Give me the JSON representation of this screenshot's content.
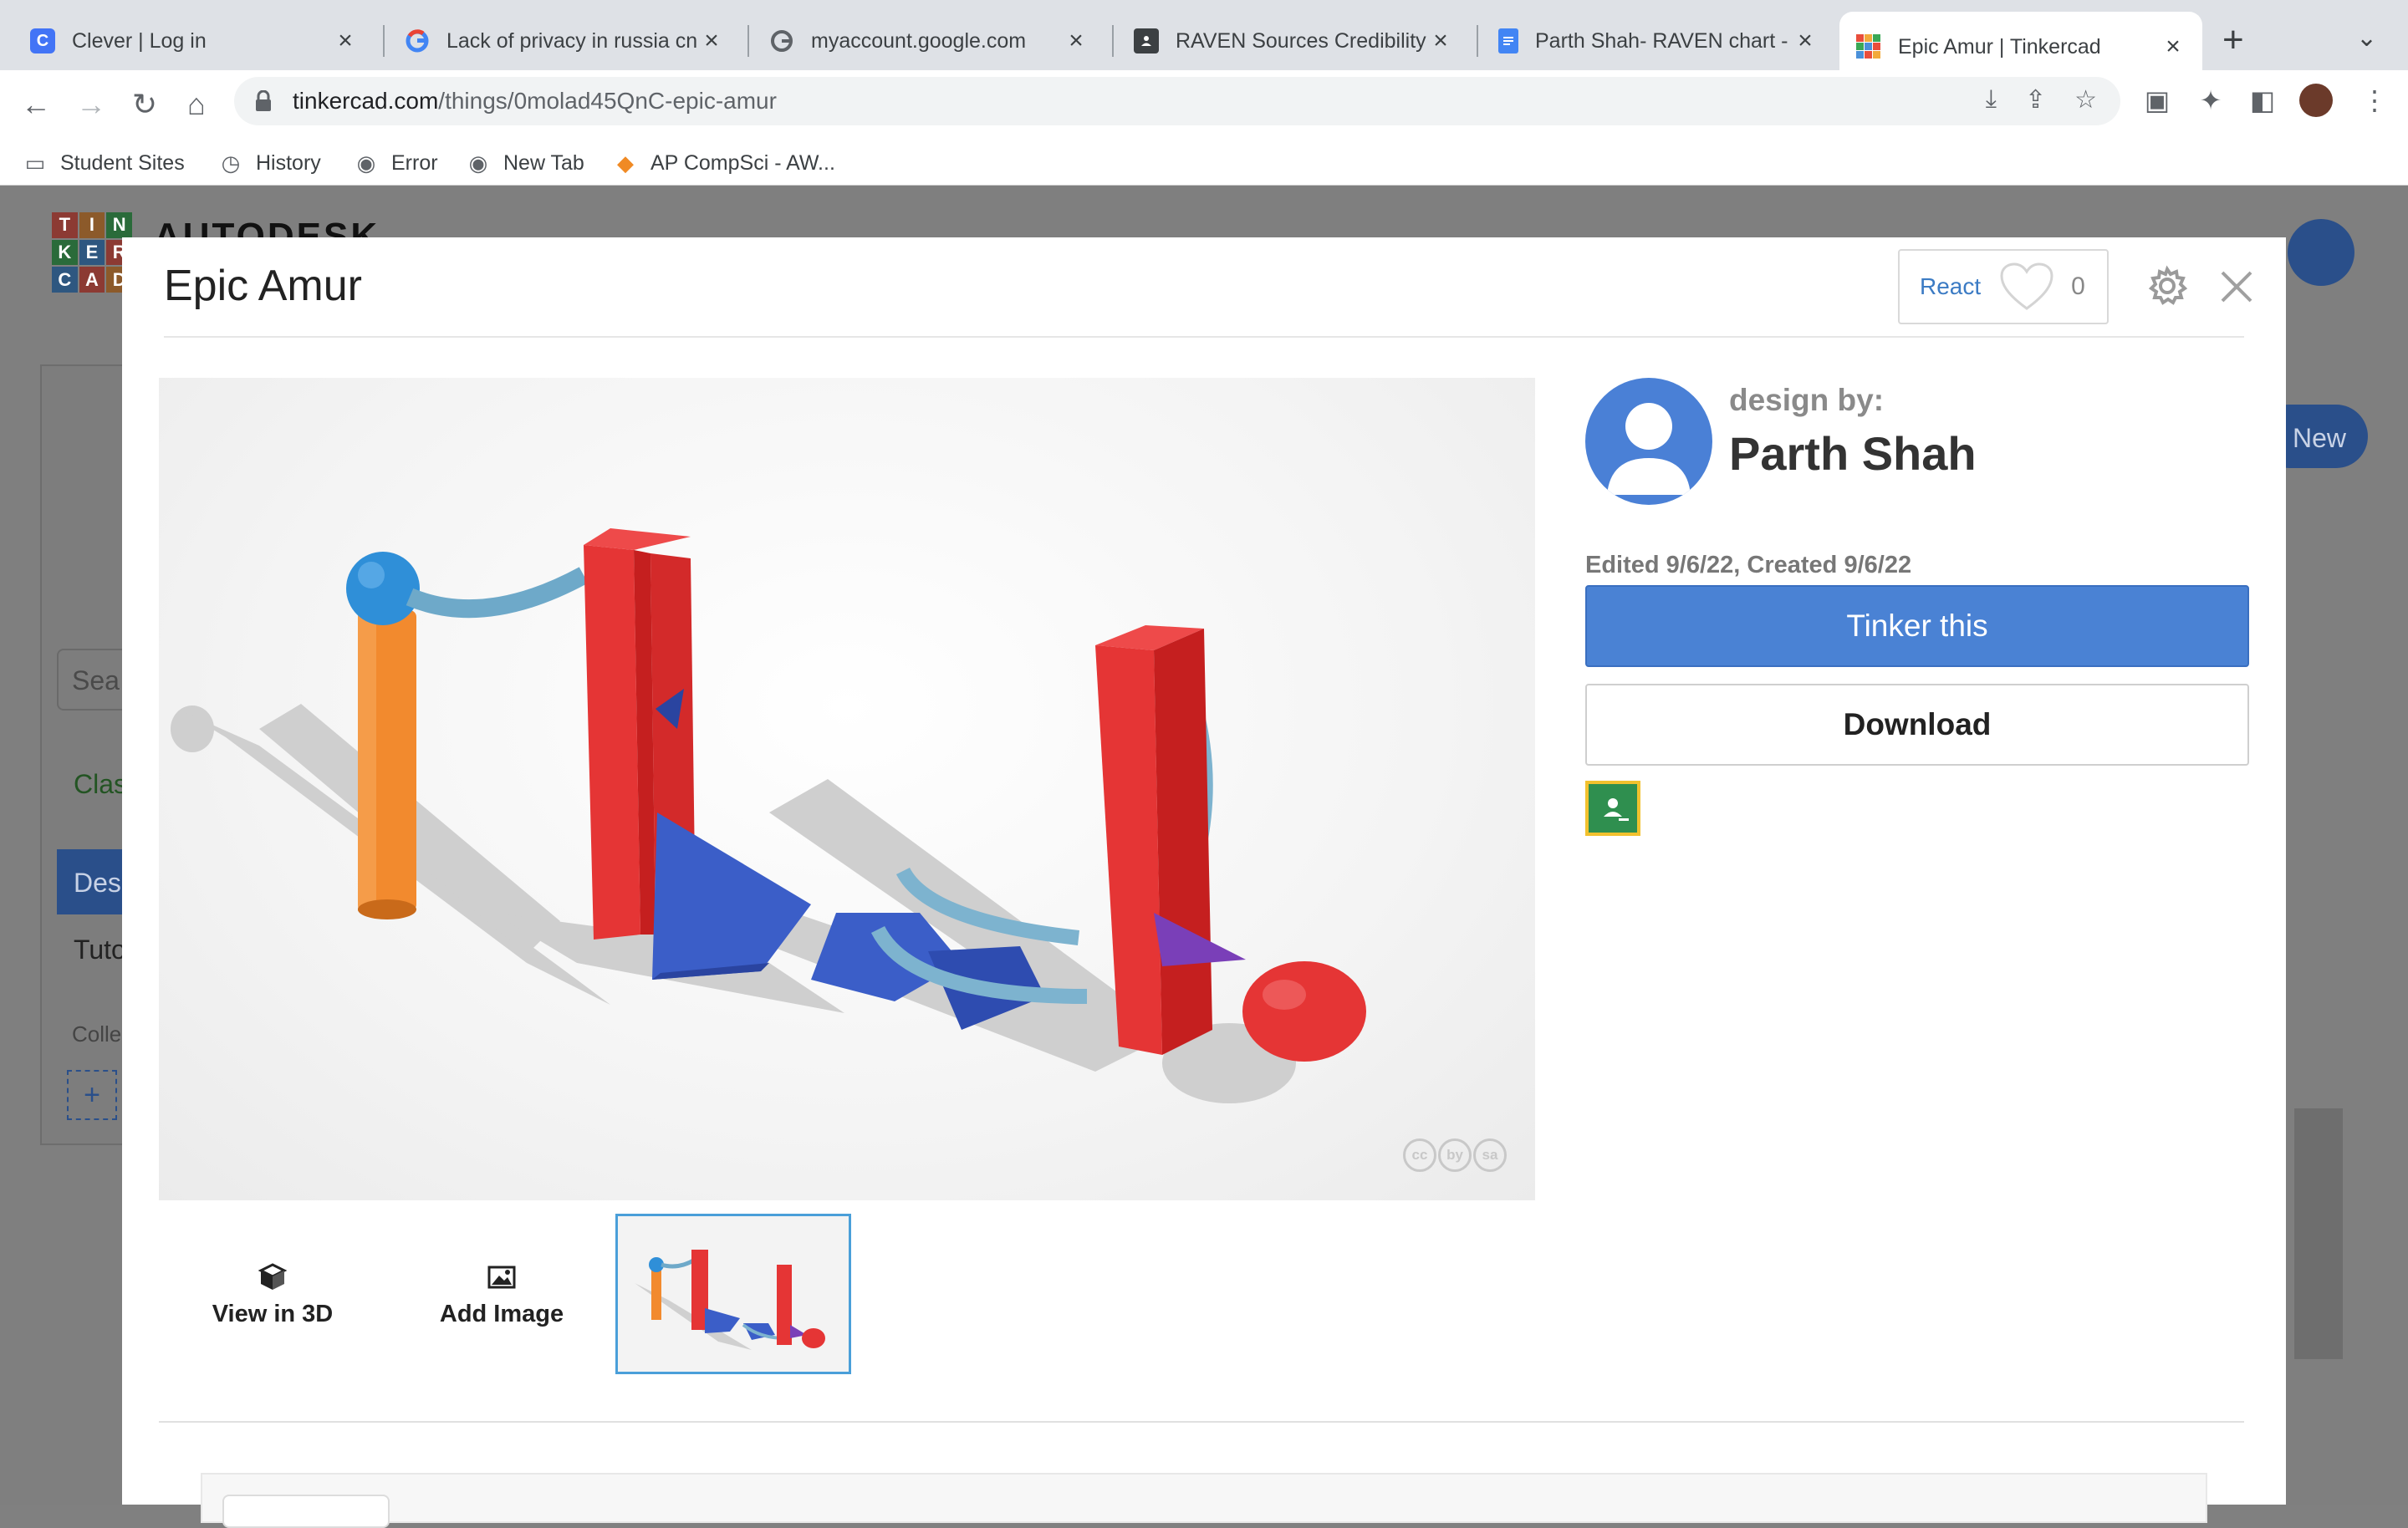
{
  "browser": {
    "tabs": [
      {
        "title": "Clever | Log in",
        "icon": "clever-icon",
        "color": "#4274f6",
        "glyph": "C"
      },
      {
        "title": "Lack of privacy in russia cn",
        "icon": "google-icon",
        "color": "#ffffff",
        "glyph": "G"
      },
      {
        "title": "myaccount.google.com",
        "icon": "google-icon",
        "color": "#ffffff",
        "glyph": "G"
      },
      {
        "title": "RAVEN Sources Credibility",
        "icon": "contact-icon",
        "color": "#5f6368",
        "glyph": "▣"
      },
      {
        "title": "Parth Shah- RAVEN chart -",
        "icon": "docs-icon",
        "color": "#4285f4",
        "glyph": "≡"
      },
      {
        "title": "Epic Amur | Tinkercad",
        "icon": "tinkercad-icon",
        "color": "#ffffff",
        "glyph": "▦"
      }
    ],
    "url_host": "tinkercad.com",
    "url_path": "/things/0molad45QnC-epic-amur",
    "bookmarks": [
      {
        "label": "Student Sites",
        "icon": "folder-icon"
      },
      {
        "label": "History",
        "icon": "history-icon"
      },
      {
        "label": "Error",
        "icon": "globe-icon"
      },
      {
        "label": "New Tab",
        "icon": "globe-icon"
      },
      {
        "label": "AP CompSci - AW...",
        "icon": "cube-icon"
      }
    ]
  },
  "background": {
    "brand": "AUTODESK",
    "logo_letters": [
      "T",
      "I",
      "N",
      "K",
      "E",
      "R",
      "C",
      "A",
      "D"
    ],
    "new_button": "New",
    "search_placeholder": "Sea",
    "classes": "Clas",
    "designs": "Des",
    "tutorials": "Tuto",
    "collections": "Colle",
    "add": "+"
  },
  "modal": {
    "title": "Epic Amur",
    "react_label": "React",
    "react_count": "0",
    "design_by_label": "design by:",
    "author": "Parth Shah",
    "dates": "Edited 9/6/22, Created 9/6/22",
    "tinker_button": "Tinker this",
    "download_button": "Download",
    "view3d_label": "View in 3D",
    "add_image_label": "Add Image",
    "license_marks": [
      "cc",
      "by",
      "sa"
    ]
  },
  "colors": {
    "accent_blue": "#4a82d4",
    "link_blue": "#3b7bc4",
    "thumb_border": "#4a9fd9"
  }
}
